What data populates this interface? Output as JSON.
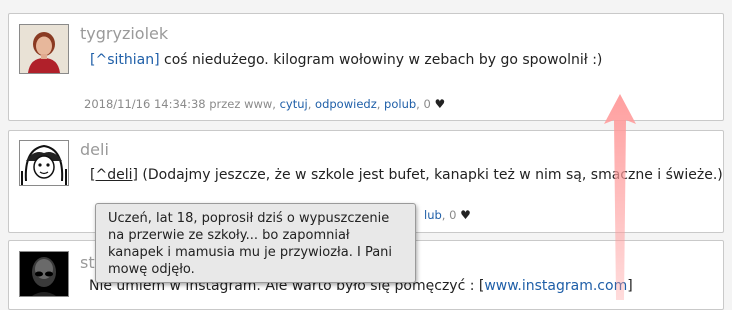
{
  "comments": [
    {
      "username": "tygryziolek",
      "mention": "[^sithian]",
      "text": " coś niedużego. kilogram wołowiny w zebach by go spowolnił :)",
      "meta_prefix": "2018/11/16 14:34:38 przez www,",
      "actions": [
        "cytuj",
        "odpowiedz",
        "polub"
      ],
      "likes": "0",
      "heart": "♥"
    },
    {
      "username": "deli",
      "mention": "[^deli]",
      "text": " (Dodajmy jeszcze, że w szkole jest bufet, kanapki też w nim są, smaczne i świeże.)",
      "meta_tail": "lub",
      "likes": "0",
      "heart": "♥"
    },
    {
      "username_fragment": "st",
      "text_prefix": "Nie umiem w instagram. Ale warto było się pomęczyć : [",
      "link": "www.instagram.com",
      "text_suffix": "]"
    }
  ],
  "tooltip": {
    "text": "Uczeń, lat 18, poprosił dziś o wypuszczenie na przerwie ze szkoły... bo zapomniał kanapek i mamusia mu je przywiozła. I Pani mowę odjęło."
  },
  "colors": {
    "link": "#1f5fa8",
    "arrow": "#ff9a9a",
    "username": "#9a9a9a"
  }
}
